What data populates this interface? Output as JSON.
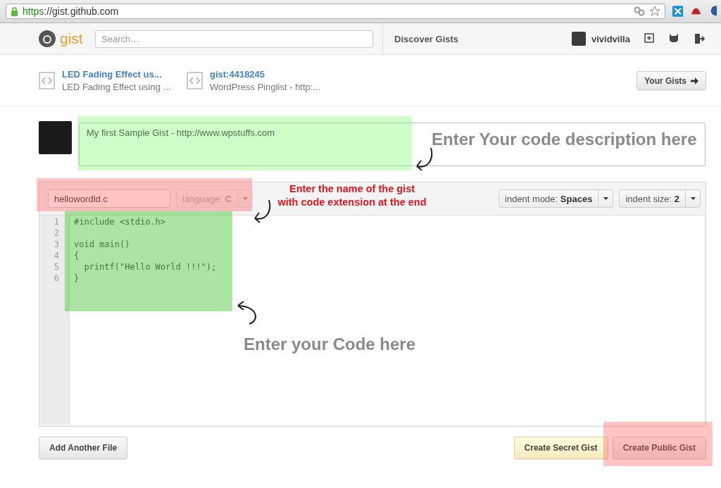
{
  "browser": {
    "url_scheme": "https",
    "url_rest": "://gist.github.com"
  },
  "header": {
    "logo_text": "gist",
    "search_placeholder": "Search…",
    "nav_link": "Discover Gists",
    "username": "vividvilla"
  },
  "recent_gists": [
    {
      "title": "LED Fading Effect us...",
      "description": "LED Fading Effect using ..."
    },
    {
      "title": "gist:4418245",
      "description": "WordPress Pinglist - http:..."
    }
  ],
  "your_gists_button": "Your Gists",
  "description": {
    "value": "My first Sample Gist - http://www.wpstuffs.com"
  },
  "file": {
    "name": "hellowordld.c",
    "language_label": "language:",
    "language_value": "C",
    "language_disabled": true,
    "indent_mode_label": "indent mode:",
    "indent_mode_value": "Spaces",
    "indent_size_label": "indent size:",
    "indent_size_value": "2"
  },
  "code_lines": [
    {
      "number": "1",
      "text": "#include <stdio.h>"
    },
    {
      "number": "2"
    },
    {
      "number": "3",
      "text": "void main()"
    },
    {
      "number": "4",
      "text": "{"
    },
    {
      "number": "5",
      "text": "  printf(\"Hello World !!!\");"
    },
    {
      "number": "6",
      "text": "}"
    }
  ],
  "buttons": {
    "add_file": "Add Another File",
    "secret": "Create Secret Gist",
    "public": "Create Public Gist"
  },
  "annotations": [
    {
      "kind": "large",
      "lines": [
        "Enter Your code description here"
      ]
    },
    {
      "kind": "red",
      "lines": [
        "Enter the name of the gist",
        "with code extension at the end"
      ]
    },
    {
      "kind": "large",
      "lines": [
        "Enter your Code here"
      ]
    }
  ]
}
